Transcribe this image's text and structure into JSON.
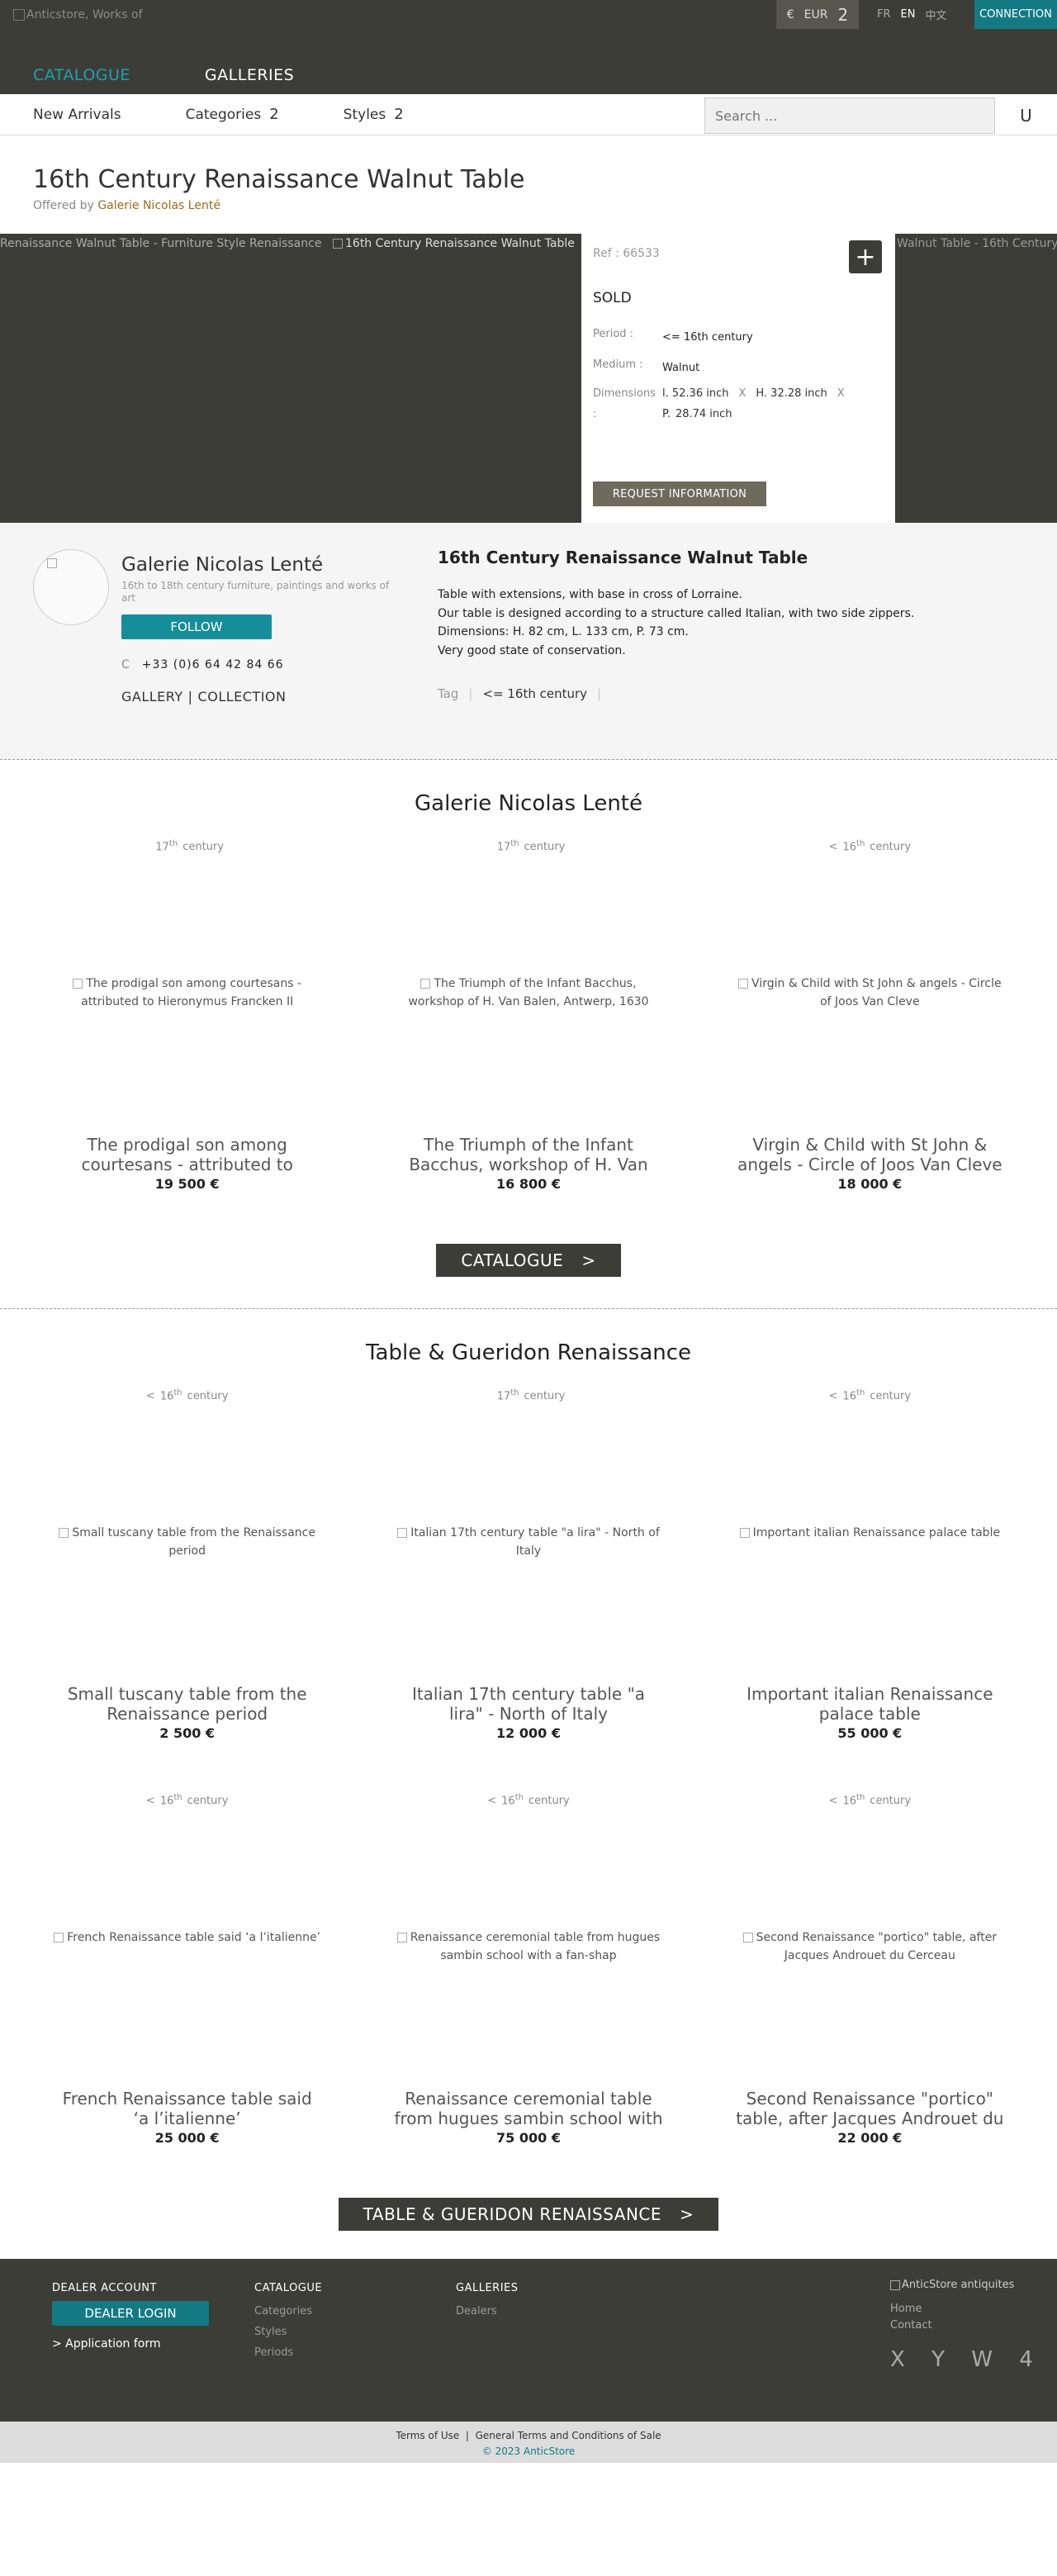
{
  "header": {
    "logo_alt": "Anticstore, Works of",
    "currency": {
      "symbol": "€",
      "code": "EUR",
      "count": "2"
    },
    "languages": [
      "FR",
      "EN",
      "中文"
    ],
    "connection": "CONNECTION",
    "nav": [
      "CATALOGUE",
      "GALLERIES"
    ]
  },
  "subnav": {
    "items": [
      {
        "label": "New Arrivals",
        "badge": ""
      },
      {
        "label": "Categories",
        "badge": "2"
      },
      {
        "label": "Styles",
        "badge": "2"
      }
    ],
    "search_placeholder": "Search ...",
    "search_button": "U"
  },
  "product": {
    "title": "16th Century Renaissance Walnut Table",
    "offered_prefix": "Offered by",
    "gallery": "Galerie Nicolas Lenté",
    "img_alt_left": "Renaissance Walnut Table - Furniture Style Renaissance",
    "img_alt_main": "16th Century Renaissance Walnut Table",
    "img_alt_right": "Walnut Table - 16th Century",
    "ref": "Ref : 66533",
    "status": "SOLD",
    "period_label": "Period :",
    "period": "<= 16th century",
    "medium_label": "Medium :",
    "medium": "Walnut",
    "dimensions_label": "Dimensions :",
    "dim_l": "l. 52.36 inch",
    "dim_h": "H. 32.28 inch",
    "dim_p": "P.",
    "dim_p_val": "28.74 inch",
    "dim_sep": "X",
    "request_button": "REQUEST INFORMATION"
  },
  "dealer": {
    "name": "Galerie Nicolas Lenté",
    "description": "16th to 18th century furniture, paintings and works of art",
    "follow": "FOLLOW",
    "phone_icon": "C",
    "phone": "+33 (0)6 64 42 84 66",
    "link_gallery": "GALLERY",
    "link_sep": "|",
    "link_collection": "COLLECTION"
  },
  "description": {
    "heading": "16th Century Renaissance Walnut Table",
    "lines": [
      "Table with extensions, with base in cross of Lorraine.",
      "Our table is designed according to a structure called Italian, with two side zippers.",
      "Dimensions: H. 82 cm, L. 133 cm, P. 73 cm.",
      "Very good state of conservation."
    ],
    "tag_label": "Tag",
    "tag": "<= 16th century"
  },
  "gallery_section": {
    "title": "Galerie Nicolas Lenté",
    "cards": [
      {
        "prefix": "",
        "num": "17",
        "sup": "th",
        "word": "century",
        "alt": "The prodigal son among courtesans - attributed to Hieronymus Francken II",
        "name": "The prodigal son among courtesans - attributed to",
        "price": "19 500 €"
      },
      {
        "prefix": "",
        "num": "17",
        "sup": "th",
        "word": "century",
        "alt": "The Triumph of the Infant Bacchus, workshop of H. Van Balen, Antwerp, 1630",
        "name": "The Triumph of the Infant Bacchus, workshop of H. Van",
        "price": "16 800 €"
      },
      {
        "prefix": "<",
        "num": "16",
        "sup": "th",
        "word": "century",
        "alt": "Virgin & Child with St John & angels - Circle of Joos Van Cleve",
        "name": "Virgin & Child with St John & angels - Circle of Joos Van Cleve",
        "price": "18 000 €"
      }
    ],
    "button": "CATALOGUE",
    "arrow": ">"
  },
  "table_section": {
    "title": "Table & Gueridon Renaissance",
    "cards": [
      {
        "prefix": "<",
        "num": "16",
        "sup": "th",
        "word": "century",
        "alt": "Small tuscany table from the Renaissance period",
        "name": "Small tuscany table from the Renaissance period",
        "price": "2 500 €"
      },
      {
        "prefix": "",
        "num": "17",
        "sup": "th",
        "word": "century",
        "alt": "Italian 17th century table \"a lira\" - North of Italy",
        "name": "Italian 17th century table \"a lira\" - North of Italy",
        "price": "12 000 €"
      },
      {
        "prefix": "<",
        "num": "16",
        "sup": "th",
        "word": "century",
        "alt": "Important italian Renaissance palace table",
        "name": "Important italian Renaissance palace table",
        "price": "55 000 €"
      },
      {
        "prefix": "<",
        "num": "16",
        "sup": "th",
        "word": "century",
        "alt": "French Renaissance table said ‘a l’italienne’",
        "name": "French Renaissance table said ‘a l’italienne’",
        "price": "25 000 €"
      },
      {
        "prefix": "<",
        "num": "16",
        "sup": "th",
        "word": "century",
        "alt": "Renaissance ceremonial table from hugues sambin school with a fan-shap",
        "name": "Renaissance ceremonial table from hugues sambin school with",
        "price": "75 000 €"
      },
      {
        "prefix": "<",
        "num": "16",
        "sup": "th",
        "word": "century",
        "alt": "Second Renaissance \"portico\" table, after Jacques Androuet du Cerceau",
        "name": "Second Renaissance \"portico\" table, after Jacques Androuet du",
        "price": "22 000 €"
      }
    ],
    "button": "TABLE & GUERIDON RENAISSANCE",
    "arrow": ">"
  },
  "footer": {
    "dealer_account": "DEALER ACCOUNT",
    "dealer_login": "DEALER LOGIN",
    "application_form": "> Application form",
    "catalogue": "CATALOGUE",
    "catalogue_links": [
      "Categories",
      "Styles",
      "Periods"
    ],
    "galleries": "GALLERIES",
    "galleries_links": [
      "Dealers"
    ],
    "logo_alt": "AnticStore antiquites",
    "right_links": [
      "Home",
      "Contact"
    ],
    "socials": "X Y W 4",
    "terms": "Terms of Use",
    "terms_sep": "|",
    "gtc": "General Terms and Conditions of Sale",
    "copyright": "© 2023 AnticStore"
  }
}
